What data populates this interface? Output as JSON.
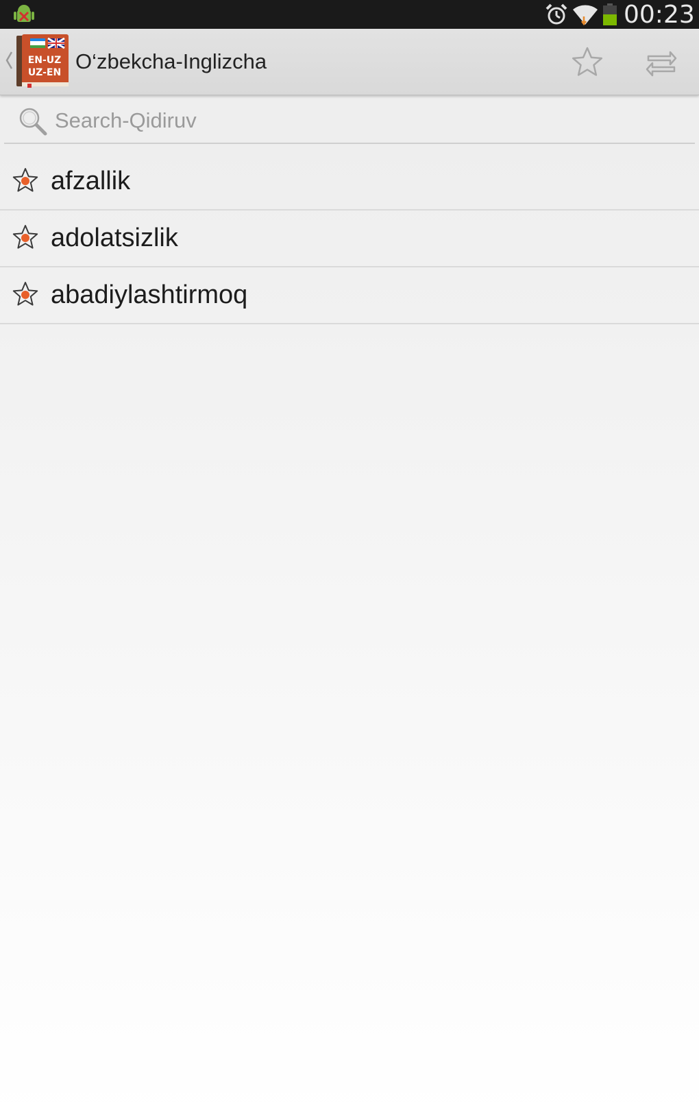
{
  "status_bar": {
    "time": "00:23",
    "icons": [
      "android-debug-icon",
      "alarm-icon",
      "wifi-icon",
      "battery-icon"
    ],
    "battery_color": "#7cb800"
  },
  "action_bar": {
    "title": "O‘zbekcha-Inglizcha",
    "logo_text_top": "EN-UZ",
    "logo_text_bottom": "UZ-EN",
    "actions": [
      "star-outline-icon",
      "swap-icon"
    ]
  },
  "search": {
    "placeholder": "Search-Qidiruv",
    "value": ""
  },
  "words": [
    {
      "text": "afzallik",
      "icon": "star-icon"
    },
    {
      "text": "adolatsizlik",
      "icon": "star-icon"
    },
    {
      "text": "abadiylashtirmoq",
      "icon": "star-icon"
    }
  ],
  "colors": {
    "status_bar_bg": "#1a1a1a",
    "action_bar_bg": "#dedede",
    "accent_orange": "#e8602a",
    "logo_book": "#c8502a"
  }
}
